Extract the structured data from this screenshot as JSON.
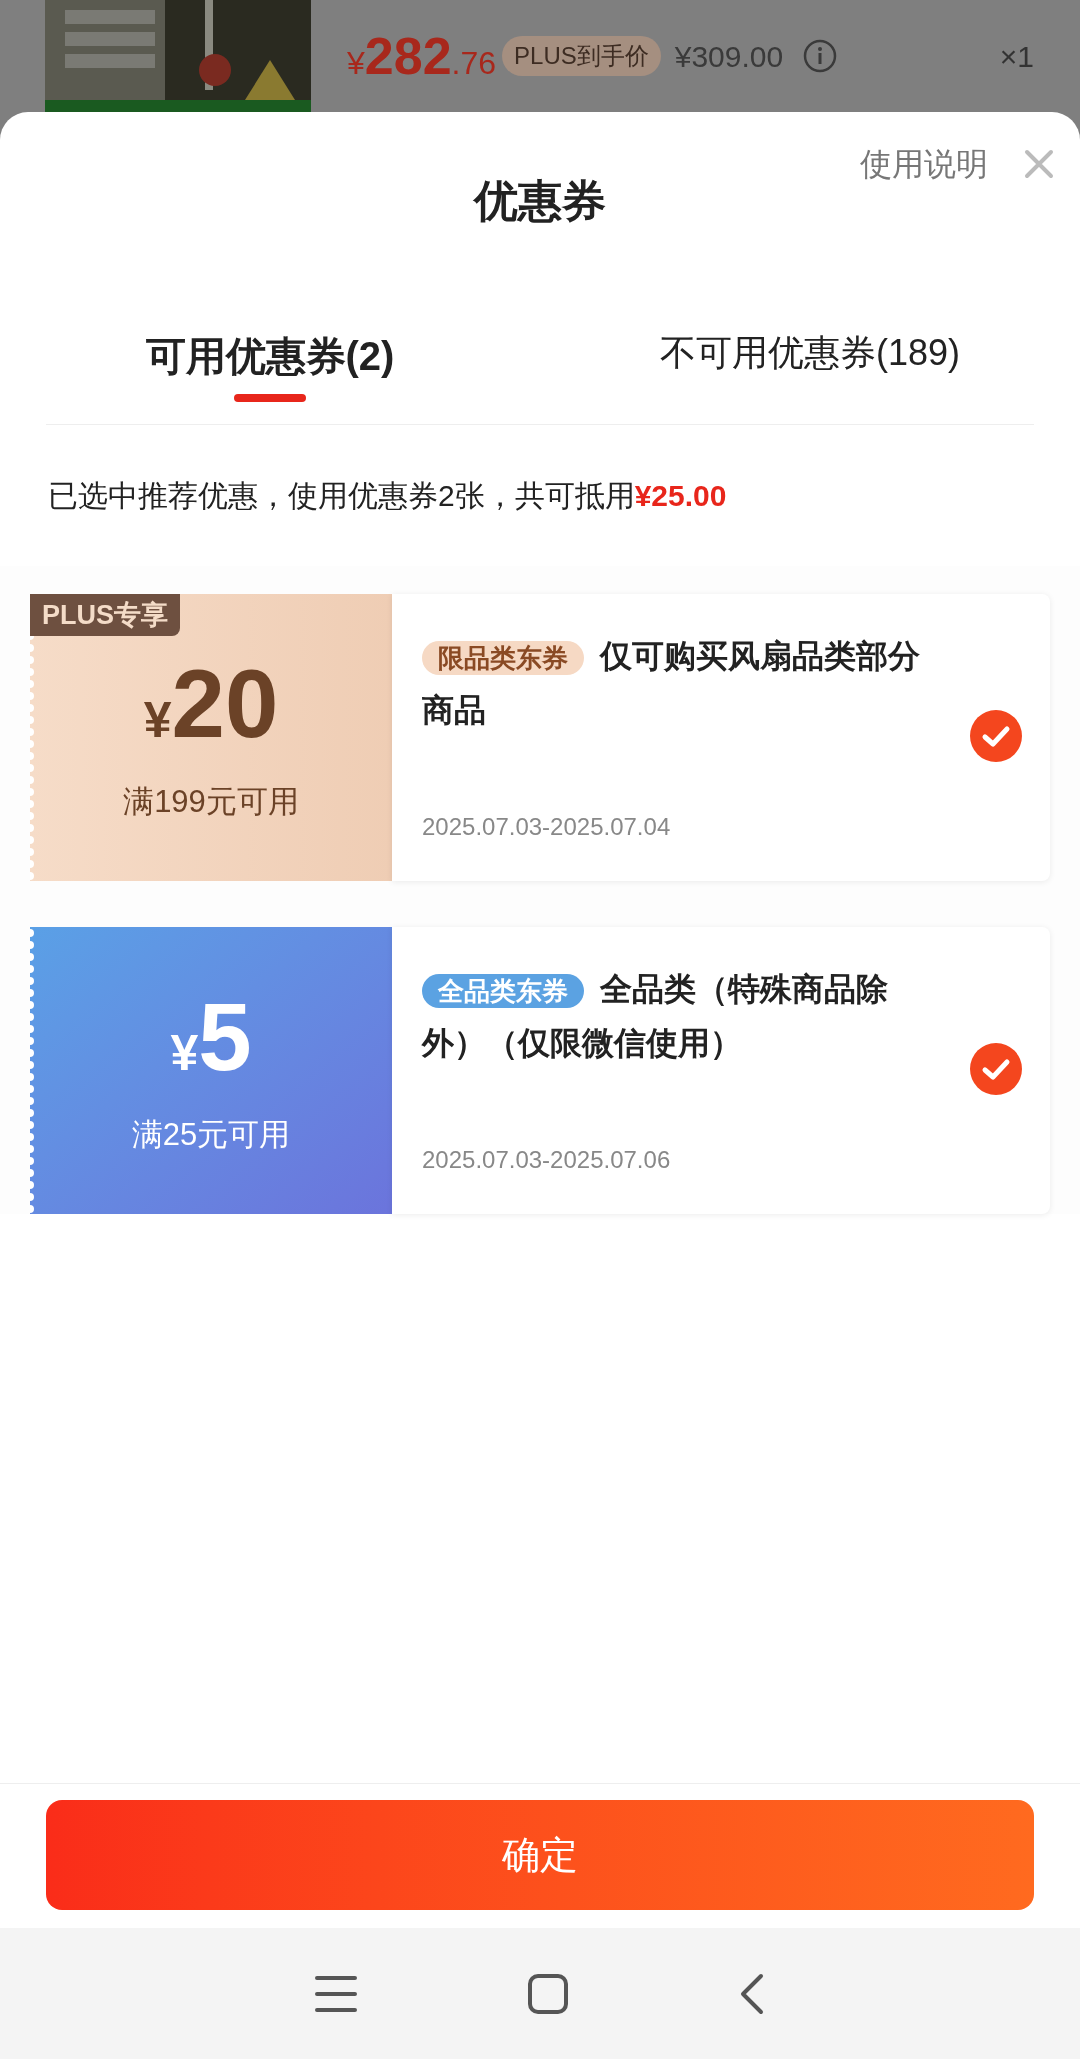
{
  "product": {
    "kind": "picture",
    "price_symbol": "¥",
    "price_integer": "282",
    "price_decimal": ".76",
    "price_tag": "PLUS到手价",
    "original_price": "¥309.00",
    "quantity": "×1"
  },
  "sheet": {
    "title": "优惠券",
    "help_link": "使用说明",
    "tabs": [
      {
        "label": "可用优惠券(2)",
        "selected": true
      },
      {
        "label": "不可用优惠券(189)",
        "selected": false
      }
    ],
    "summary": {
      "text": "已选中推荐优惠，使用优惠券2张，共可抵用",
      "amount": "¥25.00"
    },
    "coupons": [
      {
        "kind": "plus",
        "badge": "PLUS专享",
        "symbol": "¥",
        "amount": "20",
        "condition": "满199元可用",
        "tag": "限品类东券",
        "description": "仅可购买风扇品类部分商品",
        "validity": "2025.07.03-2025.07.04",
        "checked": true
      },
      {
        "kind": "general",
        "symbol": "¥",
        "amount": "5",
        "condition": "满25元可用",
        "tag": "全品类东券",
        "description": "全品类（特殊商品除外）（仅限微信使用）",
        "validity": "2025.07.03-2025.07.06",
        "checked": true
      }
    ],
    "confirm_button": "确定"
  }
}
